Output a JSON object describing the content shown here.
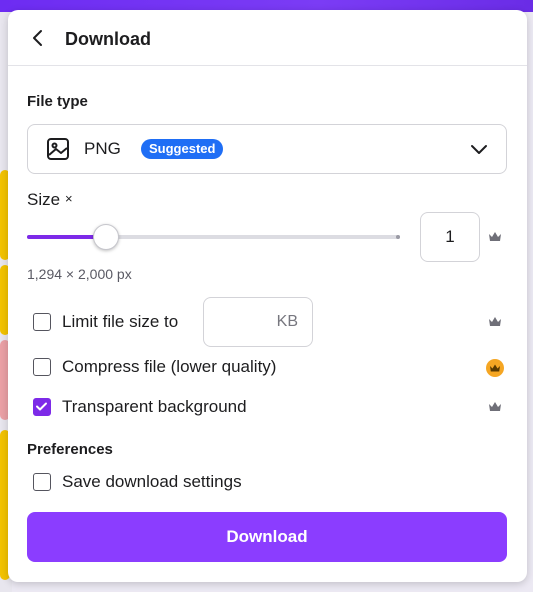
{
  "header": {
    "title": "Download"
  },
  "file_type": {
    "label": "File type",
    "selected": "PNG",
    "badge": "Suggested"
  },
  "size": {
    "label": "Size",
    "multiplier_symbol": "×",
    "value": "1",
    "slider_fraction": 0.21,
    "dimensions": "1,294 × 2,000 px"
  },
  "options": {
    "limit_file_size": {
      "label": "Limit file size to",
      "checked": false,
      "unit": "KB",
      "value": ""
    },
    "compress": {
      "label": "Compress file (lower quality)",
      "checked": false
    },
    "transparent": {
      "label": "Transparent background",
      "checked": true
    }
  },
  "preferences": {
    "label": "Preferences",
    "save_settings": {
      "label": "Save download settings",
      "checked": false
    }
  },
  "download_button": {
    "label": "Download"
  },
  "colors": {
    "accent": "#8b3dff",
    "badge": "#1f6ef5",
    "premium_gold": "#f5a623"
  }
}
